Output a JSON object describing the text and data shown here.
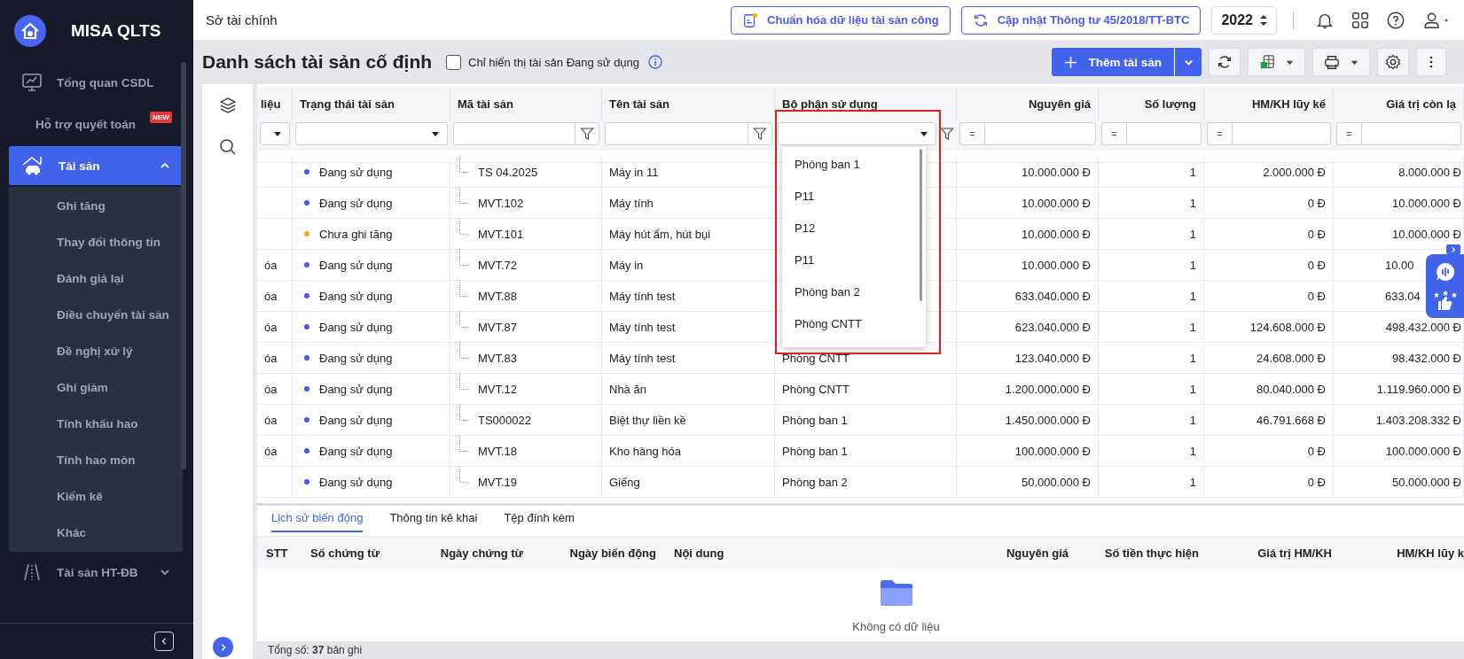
{
  "sidebar": {
    "app_name": "MISA QLTS",
    "items": [
      {
        "label": "Tổng quan CSDL",
        "selected": false
      },
      {
        "label": "Hỗ trợ quyết toán",
        "badge": "NEW",
        "selected": false
      },
      {
        "label": "Tài sản",
        "selected": true,
        "expanded": true,
        "children": [
          {
            "label": "Ghi tăng",
            "selected": false
          },
          {
            "label": "Thay đổi thông tin",
            "selected": false
          },
          {
            "label": "Đánh giá lại",
            "selected": false
          },
          {
            "label": "Điều chuyển tài sản",
            "selected": false
          },
          {
            "label": "Đề nghị xử lý",
            "selected": false
          },
          {
            "label": "Ghi giảm",
            "selected": false
          },
          {
            "label": "Tính khấu hao",
            "selected": false
          },
          {
            "label": "Tính hao mòn",
            "selected": false
          },
          {
            "label": "Kiểm kê",
            "selected": false
          },
          {
            "label": "Khác",
            "selected": false
          }
        ]
      },
      {
        "label": "Tài sản HT-ĐB",
        "selected": false,
        "expanded": false
      }
    ]
  },
  "header": {
    "title": "Sở tài chính",
    "buttons": [
      "Chuẩn hóa dữ liệu tài sản công",
      "Cập nhật Thông tư 45/2018/TT-BTC"
    ],
    "year": "2022"
  },
  "page": {
    "title": "Danh sách tài sản cố định",
    "only_in_use": {
      "label": "Chỉ hiển thị tài sản Đang sử dụng",
      "checked": false
    },
    "add_button": "Thêm tài sản"
  },
  "table": {
    "columns": [
      {
        "label": "liệu",
        "filter": {
          "kind": "select"
        }
      },
      {
        "label": "Trạng thái tài sản",
        "filter": {
          "kind": "select"
        }
      },
      {
        "label": "Mã tài sản",
        "filter": {
          "kind": "text"
        }
      },
      {
        "label": "Tên tài sản",
        "filter": {
          "kind": "text"
        }
      },
      {
        "label": "Bộ phận sử dụng",
        "filter": {
          "kind": "select_filter"
        }
      },
      {
        "label": "Nguyên giá",
        "filter": {
          "kind": "number",
          "operator": "="
        }
      },
      {
        "label": "Số lượng",
        "filter": {
          "kind": "number",
          "operator": "="
        }
      },
      {
        "label": "HM/KH lũy kế",
        "filter": {
          "kind": "number",
          "operator": "="
        }
      },
      {
        "label": "Giá trị còn lạ",
        "filter": {
          "kind": "number",
          "operator": "="
        }
      }
    ],
    "rows": [
      {
        "status": {
          "label": "Đang sử dụng",
          "color": "#3d5bf0"
        },
        "code": "TS 04.2025",
        "name": "Máy in 11",
        "cost": "10.000.000 Đ",
        "quantity": "1",
        "depreciation": "2.000.000 Đ",
        "remaining": "8.000.000 Đ"
      },
      {
        "status": {
          "label": "Đang sử dụng",
          "color": "#3d5bf0"
        },
        "code": "MVT.102",
        "name": "Máy tính",
        "cost": "10.000.000 Đ",
        "quantity": "1",
        "depreciation": "0 Đ",
        "remaining": "10.000.000 Đ"
      },
      {
        "status": {
          "label": "Chưa ghi tăng",
          "color": "#f5a623"
        },
        "code": "MVT.101",
        "name": "Máy hút ẩm, hút bụi",
        "cost": "10.000.000 Đ",
        "quantity": "1",
        "depreciation": "0 Đ",
        "remaining": "10.000.000 Đ"
      },
      {
        "column_1": "óa",
        "status": {
          "label": "Đang sử dụng",
          "color": "#3d5bf0"
        },
        "code": "MVT.72",
        "name": "Máy in",
        "cost": "10.000.000 Đ",
        "quantity": "1",
        "depreciation": "0 Đ",
        "remaining": "10.00",
        "remaining_covered": true
      },
      {
        "column_1": "óa",
        "status": {
          "label": "Đang sử dụng",
          "color": "#3d5bf0"
        },
        "code": "MVT.88",
        "name": "Máy tính test",
        "cost": "633.040.000 Đ",
        "quantity": "1",
        "depreciation": "0 Đ",
        "remaining": "633.04",
        "remaining_covered": true
      },
      {
        "column_1": "óa",
        "status": {
          "label": "Đang sử dụng",
          "color": "#3d5bf0"
        },
        "code": "MVT.87",
        "name": "Máy tính test",
        "cost": "623.040.000 Đ",
        "quantity": "1",
        "depreciation": "124.608.000 Đ",
        "remaining": "498.432.000 Đ"
      },
      {
        "column_1": "óa",
        "status": {
          "label": "Đang sử dụng",
          "color": "#3d5bf0"
        },
        "code": "MVT.83",
        "name": "Máy tính test",
        "department": "Phòng CNTT",
        "cost": "123.040.000 Đ",
        "quantity": "1",
        "depreciation": "24.608.000 Đ",
        "remaining": "98.432.000 Đ"
      },
      {
        "column_1": "óa",
        "status": {
          "label": "Đang sử dụng",
          "color": "#3d5bf0"
        },
        "code": "MVT.12",
        "name": "Nhà ăn",
        "department": "Phòng CNTT",
        "cost": "1.200.000.000 Đ",
        "quantity": "1",
        "depreciation": "80.040.000 Đ",
        "remaining": "1.119.960.000 Đ"
      },
      {
        "column_1": "óa",
        "status": {
          "label": "Đang sử dụng",
          "color": "#3d5bf0"
        },
        "code": "TS000022",
        "name": "Biệt thự liền kề",
        "department": "Phòng ban 1",
        "cost": "1.450.000.000 Đ",
        "quantity": "1",
        "depreciation": "46.791.668 Đ",
        "remaining": "1.403.208.332 Đ"
      },
      {
        "column_1": "óa",
        "status": {
          "label": "Đang sử dụng",
          "color": "#3d5bf0"
        },
        "code": "MVT.18",
        "name": "Kho hàng hóa",
        "department": "Phòng ban 1",
        "cost": "100.000.000 Đ",
        "quantity": "1",
        "depreciation": "0 Đ",
        "remaining": "100.000.000 Đ"
      },
      {
        "status": {
          "label": "Đang sử dụng",
          "color": "#3d5bf0"
        },
        "code": "MVT.19",
        "name": "Giếng",
        "department": "Phòng ban 2",
        "cost": "50.000.000 Đ",
        "quantity": "1",
        "depreciation": "0 Đ",
        "remaining": "50.000.000 Đ"
      }
    ]
  },
  "department_dropdown": {
    "options": [
      {
        "label": "Phòng ban 1",
        "selected": false
      },
      {
        "label": "P11",
        "selected": false
      },
      {
        "label": "P12",
        "selected": false
      },
      {
        "label": "P11",
        "selected": false
      },
      {
        "label": "Phòng ban 2",
        "selected": false
      },
      {
        "label": "Phòng CNTT",
        "selected": false
      }
    ]
  },
  "detail": {
    "tabs": [
      {
        "label": "Lịch sử biến động",
        "selected": true
      },
      {
        "label": "Thông tin kê khai",
        "selected": false
      },
      {
        "label": "Tệp đính kèm",
        "selected": false
      }
    ],
    "columns": [
      "STT",
      "Số chứng từ",
      "Ngày chứng từ",
      "Ngày biến động",
      "Nội dung",
      "Nguyên giá",
      "Số tiền thực hiện",
      "Giá trị HM/KH",
      "HM/KH lũy k"
    ],
    "empty_text": "Không có dữ liệu"
  },
  "status_bar": {
    "total": "Tổng số: **37** bản ghi"
  }
}
